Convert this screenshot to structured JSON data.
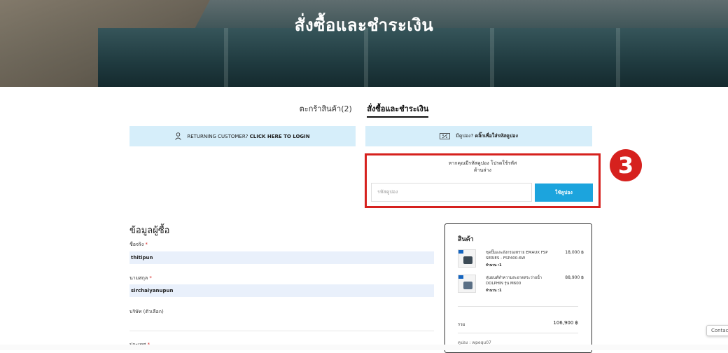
{
  "page": {
    "title": "สั่งซื้อและชำระเงิน"
  },
  "steps": {
    "cart": "ตะกร้าสินค้า(2)",
    "checkout": "สั่งซื้อและชำระเงิน"
  },
  "notices": {
    "login_prefix": "RETURNING CUSTOMER?",
    "login_link": "CLICK HERE TO LOGIN",
    "coupon_prefix": "มีคูปอง?",
    "coupon_link": "คลิ๊กเพื่อใส่รหัสคูปอง"
  },
  "coupon": {
    "message_line1": "หากคุณมีรหัสคูปอง โปรดใช้รหัส",
    "message_line2": "ด้านล่าง",
    "placeholder": "รหัสคูปอง",
    "apply_label": "ใช้คูปอง"
  },
  "annotation": {
    "step_number": "3"
  },
  "billing": {
    "title": "ข้อมูลผู้ซื้อ",
    "first_name_label": "ชื่อจริง",
    "first_name_value": "thitipun",
    "last_name_label": "นามสกุล",
    "last_name_value": "sirchaiyanupun",
    "company_label": "บริษัท (ตัวเลือก)",
    "country_label": "ประเทศ",
    "required_mark": "*"
  },
  "order": {
    "title": "สินค้า",
    "items": [
      {
        "name": "ชุดปั๊มและถังกรองทราย EMAUX FSP SERIES - FSP400-6W",
        "qty": "จำนวน :1",
        "price": "18,000 ฿"
      },
      {
        "name": "หุ่นยนต์ทำความสะอาดสระว่ายน้ำ DOLPHIN รุ่น M600",
        "qty": "จำนวน :1",
        "price": "88,900 ฿"
      }
    ],
    "subtotal_label": "รวม",
    "subtotal_value": "106,900 ฿",
    "coupon_applied": "คูปอง : wpequ07"
  },
  "widget": {
    "contact_label": "Contac"
  }
}
